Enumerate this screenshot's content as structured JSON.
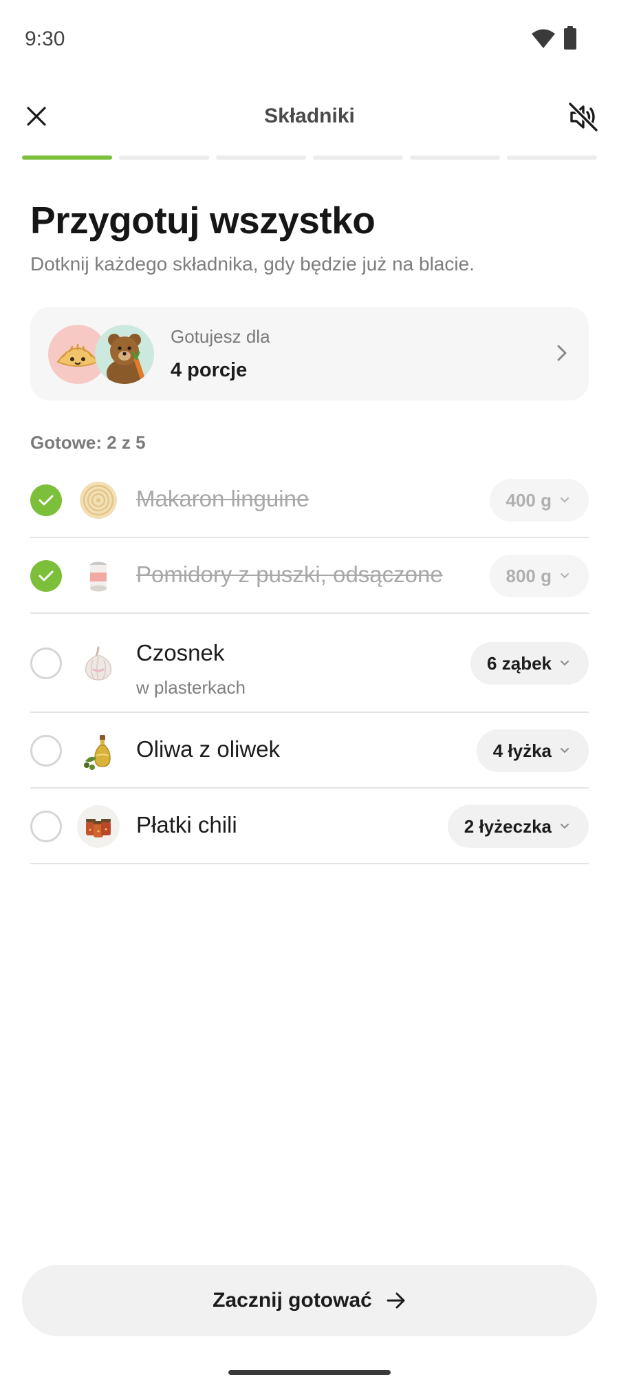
{
  "status_bar": {
    "time": "9:30",
    "wifi_icon": "wifi-icon",
    "battery_icon": "battery-icon"
  },
  "top_bar": {
    "title": "Składniki",
    "close_icon": "close-icon",
    "mute_icon": "volume-off-icon"
  },
  "progress": {
    "total_steps": 6,
    "current_step": 1,
    "active_color": "#7bbf3a"
  },
  "header": {
    "title": "Przygotuj wszystko",
    "subtitle": "Dotknij każdego składnika, gdy będzie już na blacie."
  },
  "servings": {
    "label": "Gotujesz dla",
    "value": "4 porcje",
    "avatars": [
      "dumpling-avatar",
      "bear-avatar"
    ]
  },
  "ready_count": "Gotowe: 2 z 5",
  "ingredients": [
    {
      "name": "Makaron linguine",
      "note": "",
      "quantity": "400 g",
      "done": true,
      "icon": "pasta-icon"
    },
    {
      "name": "Pomidory z puszki, odsączone",
      "note": "",
      "quantity": "800 g",
      "done": true,
      "icon": "can-icon"
    },
    {
      "name": "Czosnek",
      "note": "w plasterkach",
      "quantity": "6 ząbek",
      "done": false,
      "icon": "garlic-icon"
    },
    {
      "name": "Oliwa z oliwek",
      "note": "",
      "quantity": "4 łyżka",
      "done": false,
      "icon": "olive-oil-icon"
    },
    {
      "name": "Płatki chili",
      "note": "",
      "quantity": "2 łyżeczka",
      "done": false,
      "icon": "chili-flakes-icon"
    }
  ],
  "cta": {
    "label": "Zacznij gotować",
    "icon": "arrow-right-icon"
  },
  "colors": {
    "accent": "#7bbf3a",
    "card_bg": "#f6f6f6",
    "muted_text": "#7d7d7d"
  }
}
